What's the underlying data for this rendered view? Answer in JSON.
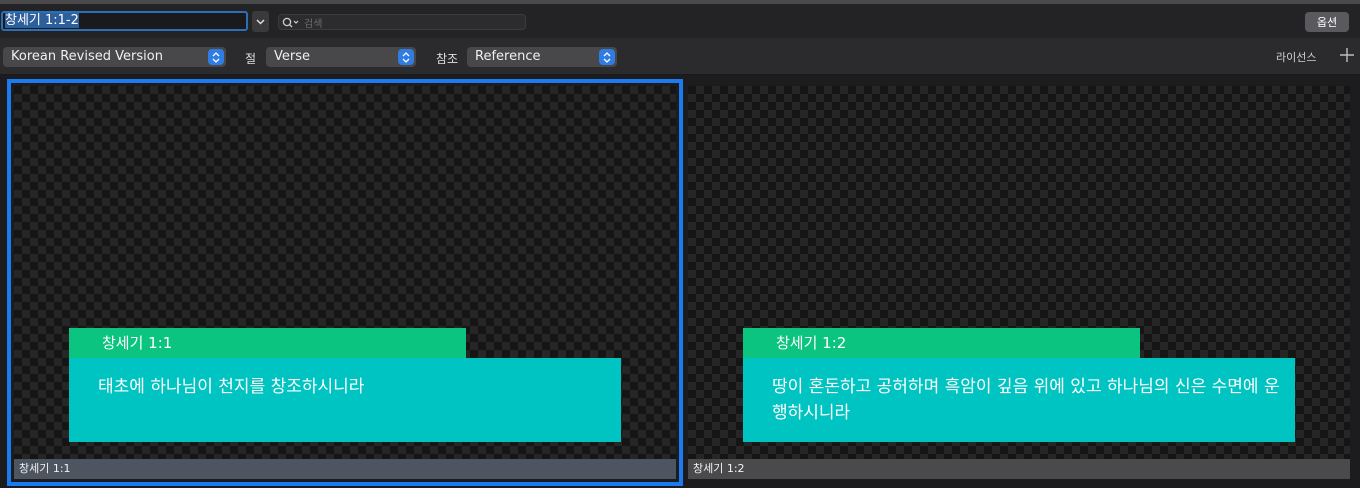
{
  "toolbar": {
    "passage_value": "창세기 1:1-2",
    "search_placeholder": "검색",
    "options_label": "옵션"
  },
  "settings": {
    "translation": "Korean Revised Version",
    "verse_label": "절",
    "verse_value": "Verse",
    "reference_label": "참조",
    "reference_value": "Reference",
    "license_label": "라이선스"
  },
  "slides": [
    {
      "reference": "창세기 1:1",
      "text": "태초에 하나님이 천지를 창조하시니라",
      "caption": "창세기 1:1",
      "selected": true
    },
    {
      "reference": "창세기 1:2",
      "text": "땅이 혼돈하고 공허하며 흑암이 깊음 위에 있고 하나님의 신은 수면에 운행하시니라",
      "caption": "창세기 1:2",
      "selected": false
    }
  ],
  "colors": {
    "accent": "#1a7cf0",
    "reference_bar": "#0ac47f",
    "text_box": "#00c4c1"
  },
  "icons": {
    "dropdown": "chevron-down-icon",
    "search": "magnifier-icon",
    "stepper": "up-down-chevron-icon",
    "add": "plus-icon"
  }
}
